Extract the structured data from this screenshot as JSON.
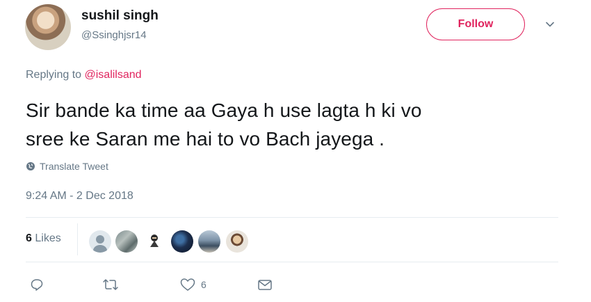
{
  "user": {
    "name": "sushil singh",
    "handle": "@Ssinghjsr14"
  },
  "follow_label": "Follow",
  "reply": {
    "prefix": "Replying to ",
    "mention": "@isalilsand"
  },
  "tweet": {
    "line1": "Sir bande ka time aa Gaya h use lagta h ki vo",
    "line2": "sree ke Saran me hai to vo Bach jayega ."
  },
  "translate_label": "Translate Tweet",
  "timestamp": "9:24 AM - 2 Dec 2018",
  "likes": {
    "count": "6",
    "label": "Likes"
  },
  "actions": {
    "like_count": "6"
  },
  "colors": {
    "accent": "#e0245e",
    "muted": "#657786",
    "text": "#14171a",
    "divider": "#e6ecf0"
  },
  "icons": [
    "chevron-down-icon",
    "globe-icon",
    "reply-icon",
    "retweet-icon",
    "heart-icon",
    "envelope-icon"
  ]
}
